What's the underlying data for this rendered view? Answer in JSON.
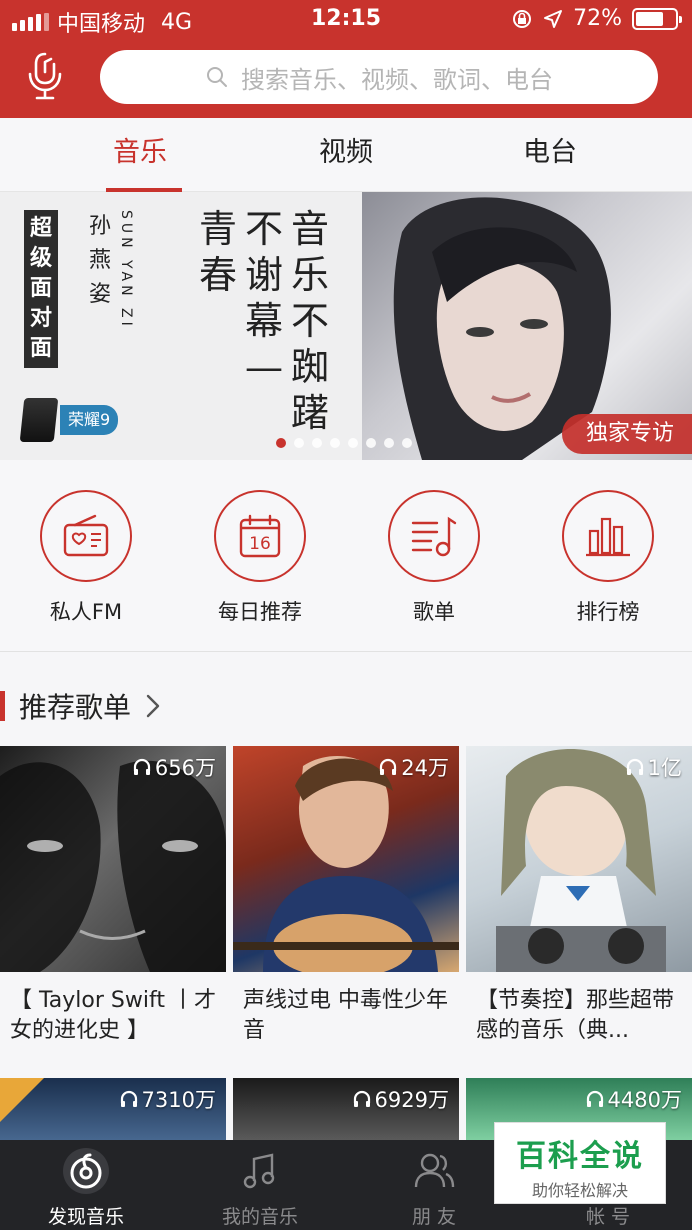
{
  "status": {
    "carrier": "中国移动",
    "network": "4G",
    "time": "12:15",
    "battery": "72%",
    "battery_level": 0.72
  },
  "search": {
    "placeholder": "搜索音乐、视频、歌词、电台"
  },
  "tabs": [
    {
      "label": "音乐"
    },
    {
      "label": "视频"
    },
    {
      "label": "电台"
    }
  ],
  "banner": {
    "tag": "超级面对面",
    "name": "孙燕姿",
    "pinyin": "SUN YAN ZI",
    "lines": [
      "音乐不踟躇",
      "不谢幕—",
      "青春"
    ],
    "sponsor": "荣耀9",
    "badge": "独家专访",
    "dot_count": 8,
    "active_dot": 0
  },
  "quick": [
    {
      "label": "私人FM",
      "icon": "radio-icon"
    },
    {
      "label": "每日推荐",
      "icon": "calendar-icon",
      "date": "16"
    },
    {
      "label": "歌单",
      "icon": "playlist-icon"
    },
    {
      "label": "排行榜",
      "icon": "chart-icon"
    }
  ],
  "section": {
    "title": "推荐歌单"
  },
  "playlists": [
    {
      "plays": "656万",
      "title": "【 Taylor Swift 丨才女的进化史 】"
    },
    {
      "plays": "24万",
      "title": "声线过电 中毒性少年音"
    },
    {
      "plays": "1亿",
      "title": "【节奏控】那些超带感的音乐（典..."
    },
    {
      "plays": "7310万",
      "title": ""
    },
    {
      "plays": "6929万",
      "title": ""
    },
    {
      "plays": "4480万",
      "title": ""
    }
  ],
  "bottom_nav": [
    {
      "label": "发现音乐"
    },
    {
      "label": "我的音乐"
    },
    {
      "label": "朋 友"
    },
    {
      "label": "帐 号"
    }
  ],
  "watermark": {
    "title": "百科全说",
    "subtitle": "助你轻松解决"
  },
  "colors": {
    "brand": "#c8332d",
    "nav_bg": "#232427",
    "watermark_green": "#1c9e4e"
  }
}
